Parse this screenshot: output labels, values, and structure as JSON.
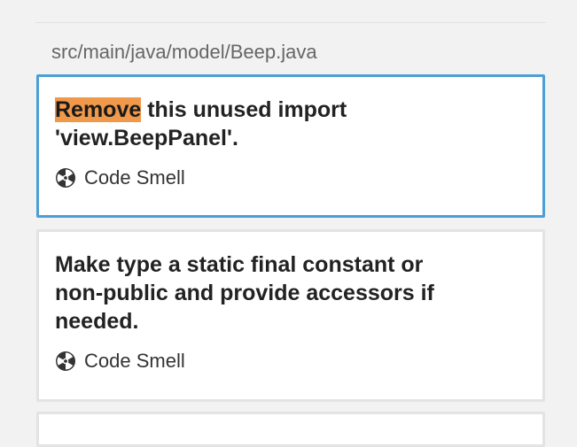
{
  "file": {
    "path": "src/main/java/model/Beep.java"
  },
  "issues": [
    {
      "highlight": "Remove",
      "message_line1_rest": " this unused import",
      "message_line2": "'view.BeepPanel'.",
      "type_label": "Code Smell",
      "type_icon": "code-smell-icon",
      "selected": true
    },
    {
      "message_line1": "Make type a static final constant or",
      "message_line2": "non-public and provide accessors if",
      "message_line3": "needed.",
      "type_label": "Code Smell",
      "type_icon": "code-smell-icon",
      "selected": false
    }
  ],
  "colors": {
    "selected_border": "#4b9fd5",
    "highlight": "#f0994a"
  }
}
